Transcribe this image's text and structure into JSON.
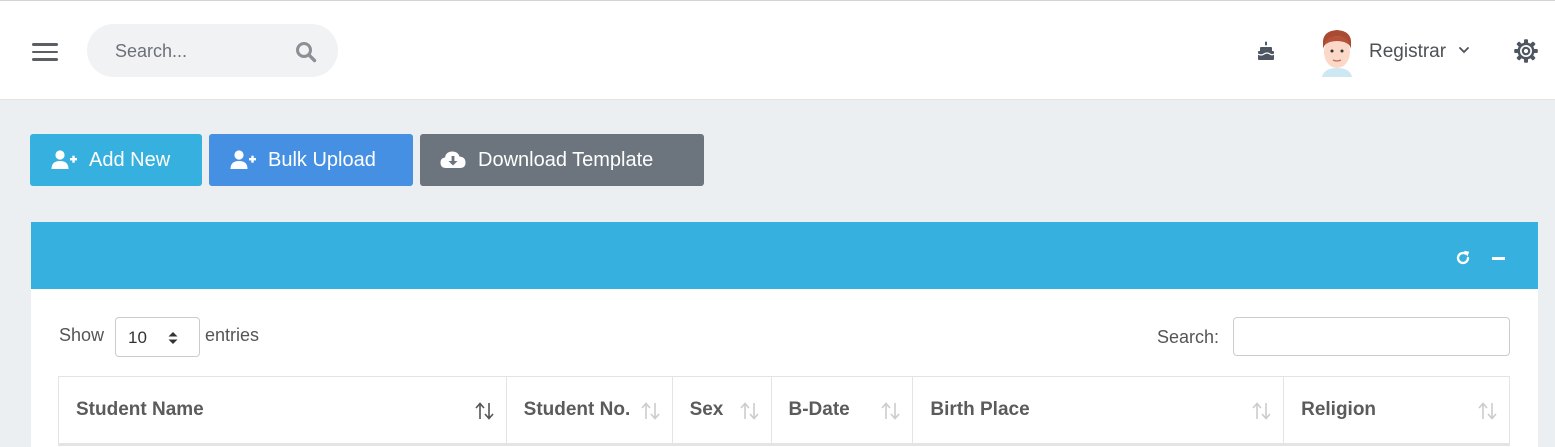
{
  "header": {
    "search_placeholder": "Search...",
    "user_name": "Registrar",
    "icons": [
      "hamburger-menu-icon",
      "search-icon",
      "cake-icon",
      "chevron-down-icon",
      "gear-icon"
    ]
  },
  "actions": {
    "add_new": "Add New",
    "bulk_upload": "Bulk Upload",
    "download_template": "Download Template"
  },
  "colors": {
    "info": "#36b0de",
    "primary": "#4590e3",
    "secondary": "#6c757d",
    "background": "#eceff1"
  },
  "table_controls": {
    "show_label": "Show",
    "entries_value": "10",
    "entries_label": "entries",
    "search_label": "Search:",
    "search_value": ""
  },
  "table": {
    "columns": [
      "Student Name",
      "Student No.",
      "Sex",
      "B-Date",
      "Birth Place",
      "Religion"
    ],
    "sorted_column": "Student Name"
  }
}
